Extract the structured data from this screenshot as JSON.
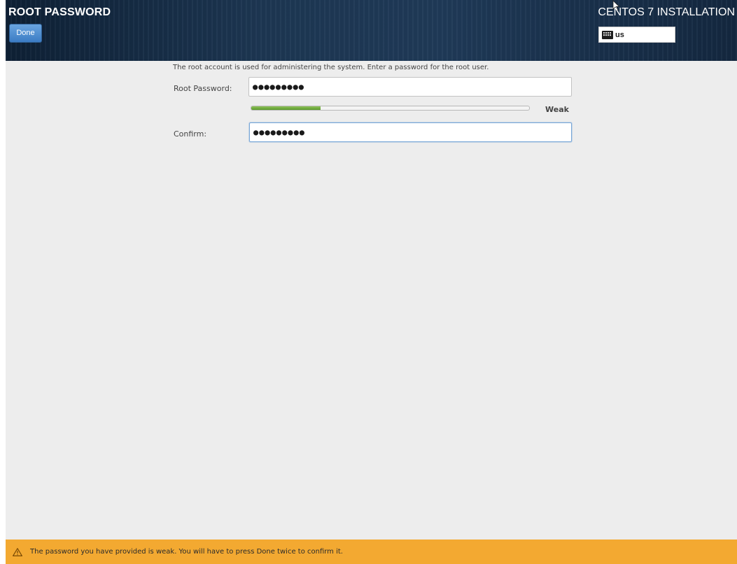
{
  "header": {
    "page_title": "ROOT PASSWORD",
    "done_label": "Done",
    "product_title": "CENTOS 7 INSTALLATION",
    "keyboard_layout": "us",
    "keyboard_icon": "keyboard-icon"
  },
  "form": {
    "intro": "The root account is used for administering the system.  Enter a password for the root user.",
    "root_password_label": "Root Password:",
    "root_password_value": "●●●●●●●●●",
    "strength_label": "Weak",
    "strength_fraction": 0.25,
    "confirm_label": "Confirm:",
    "confirm_value": "●●●●●●●●●"
  },
  "warning": {
    "icon": "warning-icon",
    "text": "The password you have provided is weak. You will have to press Done twice to confirm it."
  },
  "colors": {
    "header_bg": "#1d3753",
    "done_button": "#4a8bd0",
    "content_bg": "#ededed",
    "strength_fill": "#6aa83a",
    "warning_bg": "#f3a931"
  }
}
